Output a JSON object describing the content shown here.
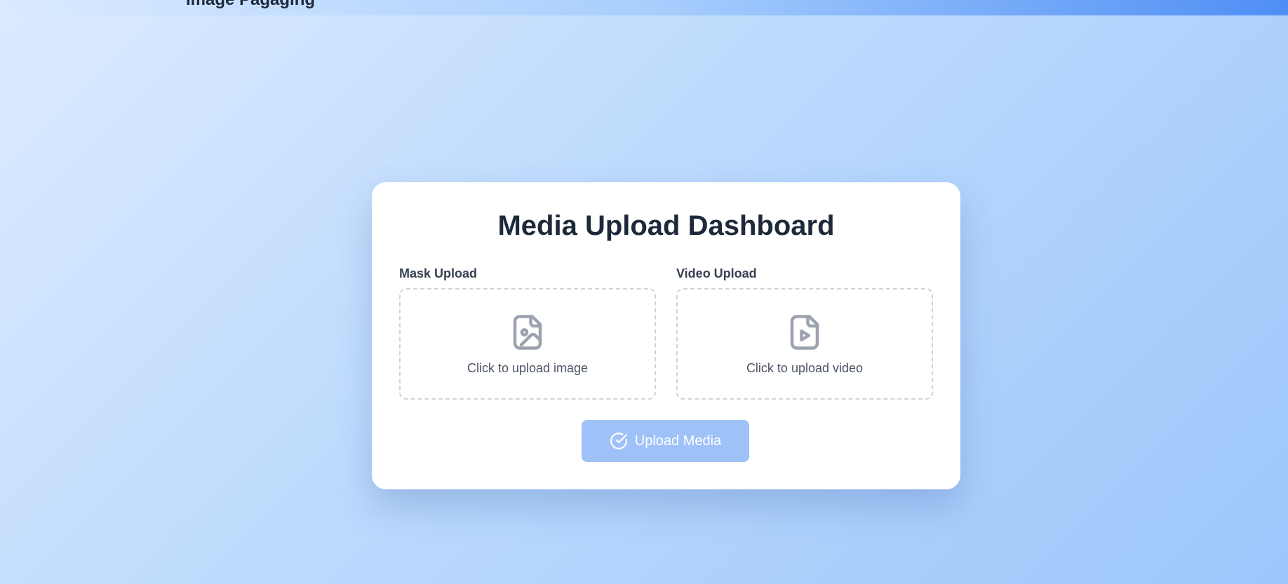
{
  "header": {
    "partial_title": "Image Pagaging"
  },
  "card": {
    "title": "Media Upload Dashboard"
  },
  "mask_upload": {
    "label": "Mask Upload",
    "prompt": "Click to upload image",
    "icon": "file-image-icon"
  },
  "video_upload": {
    "label": "Video Upload",
    "prompt": "Click to upload video",
    "icon": "file-video-icon"
  },
  "submit": {
    "label": "Upload Media",
    "icon": "check-circle-icon",
    "disabled": true
  },
  "colors": {
    "accent": "#3b82f6",
    "button_disabled": "#9ec1f7",
    "title_text": "#1e293b",
    "icon_gray": "#9ca3af"
  }
}
